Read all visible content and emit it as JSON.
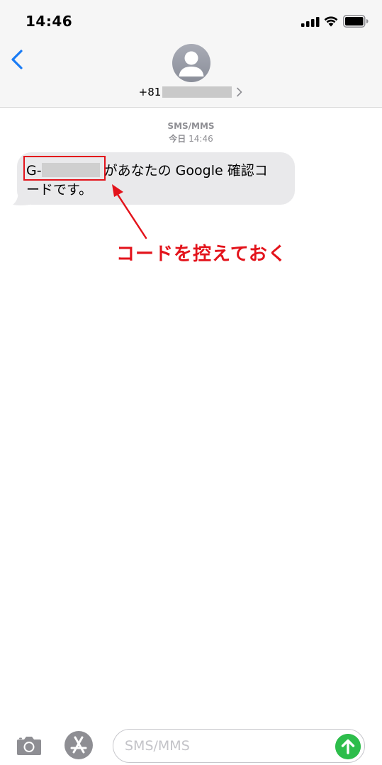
{
  "status_bar": {
    "time": "14:46",
    "icons": [
      "signal-icon",
      "wifi-icon",
      "battery-icon"
    ]
  },
  "header": {
    "back_icon": "chevron-left-icon",
    "avatar_icon": "person-icon",
    "contact_number_prefix": "+81",
    "contact_chevron_icon": "chevron-right-icon"
  },
  "conversation": {
    "service_label": "SMS/MMS",
    "timestamp_day": "今日",
    "timestamp_time": "14:46",
    "message": {
      "code_prefix": "G-",
      "text_line1": "があなたの Google 確認コ",
      "text_line2": "ードです。"
    }
  },
  "annotation": {
    "label": "コードを控えておく",
    "color": "#e3131b"
  },
  "input_bar": {
    "camera_icon": "camera-icon",
    "appstore_icon": "app-store-icon",
    "placeholder": "SMS/MMS",
    "send_icon": "arrow-up-icon",
    "send_color": "#2dbd4b"
  }
}
